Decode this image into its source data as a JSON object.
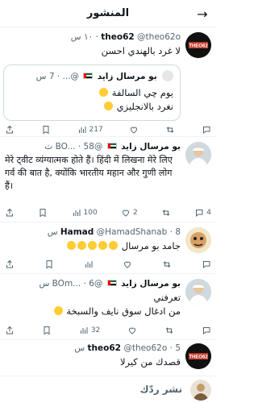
{
  "header": {
    "title": "المنشور"
  },
  "posts": [
    {
      "name": "theo62",
      "handle": "@theo62o",
      "time": "١٠ س",
      "text": "لا غرد بالهندي احسن",
      "quote": {
        "name": "بو مرسال زايد",
        "handle": "@...",
        "time": "7 س",
        "text_line1": "يوم چي السالفة",
        "text_line2": "نغرد بالانجليزي"
      },
      "stats": {
        "views": "217",
        "likes": "",
        "retweets": "",
        "replies": ""
      }
    },
    {
      "name": "بو مرسال زايد",
      "handle": "@BO...",
      "time": "58 ث",
      "text": "मेरे ट्वीट व्यंग्यात्मक होते हैं। हिंदी में लिखना मेरे लिए गर्व की बात है, क्योंकि भारतीय महान और गुणी लोग हैं।",
      "stats": {
        "views": "100",
        "likes": "2",
        "retweets": "",
        "replies": "4"
      }
    },
    {
      "name": "Hamad",
      "handle": "@HamadShanab",
      "time": "8 س",
      "text": "جامد بو مرسال",
      "stats": {
        "views": "",
        "likes": "",
        "retweets": "",
        "replies": ""
      }
    },
    {
      "name": "بو مرسال زايد",
      "handle": "@BOm...",
      "time": "6 س",
      "text_line1": "تعرفني",
      "text_line2": "من ادغال سوق نايف والسبخة",
      "stats": {
        "views": "32",
        "likes": "",
        "retweets": "",
        "replies": ""
      }
    },
    {
      "name": "theo62",
      "handle": "@theo62o",
      "time": "5 س",
      "text": "قصدك من كيرلا"
    }
  ],
  "reply_bar": {
    "placeholder": "نشر ردّك"
  },
  "colors": {
    "verified": "#1d9bf0",
    "muted": "#536471",
    "divider": "#eff3f4"
  }
}
